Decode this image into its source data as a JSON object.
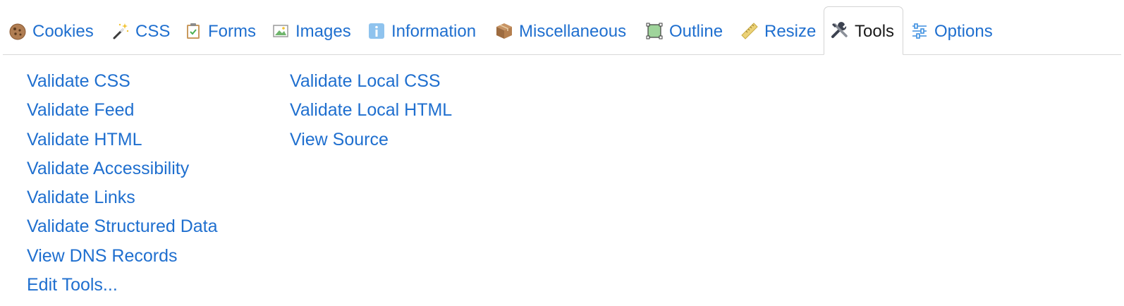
{
  "tabs": [
    {
      "label": "Cookies",
      "icon": "cookie-icon",
      "active": false
    },
    {
      "label": "CSS",
      "icon": "magic-wand-icon",
      "active": false
    },
    {
      "label": "Forms",
      "icon": "clipboard-icon",
      "active": false
    },
    {
      "label": "Images",
      "icon": "image-icon",
      "active": false
    },
    {
      "label": "Information",
      "icon": "info-icon",
      "active": false
    },
    {
      "label": "Miscellaneous",
      "icon": "package-icon",
      "active": false
    },
    {
      "label": "Outline",
      "icon": "outline-square-icon",
      "active": false
    },
    {
      "label": "Resize",
      "icon": "ruler-icon",
      "active": false
    },
    {
      "label": "Tools",
      "icon": "tools-icon",
      "active": true
    },
    {
      "label": "Options",
      "icon": "sliders-icon",
      "active": false
    }
  ],
  "tools": {
    "column1": [
      "Validate CSS",
      "Validate Feed",
      "Validate HTML",
      "Validate Accessibility",
      "Validate Links",
      "Validate Structured Data",
      "View DNS Records",
      "Edit Tools..."
    ],
    "column2": [
      "Validate Local CSS",
      "Validate Local HTML",
      "View Source"
    ]
  },
  "colors": {
    "link": "#1f6fcf",
    "active_text": "#1a1a1a",
    "border": "#d4d4d4"
  }
}
